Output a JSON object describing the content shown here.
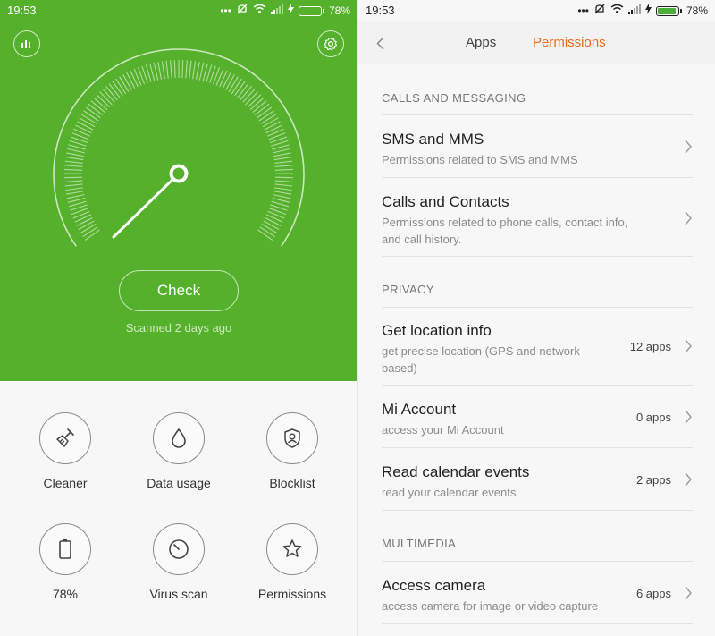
{
  "left": {
    "status": {
      "time": "19:53",
      "battery": "78%"
    },
    "check_label": "Check",
    "scanned_text": "Scanned 2 days ago",
    "tools": [
      {
        "label": "Cleaner",
        "icon": "broom-icon"
      },
      {
        "label": "Data usage",
        "icon": "droplet-icon"
      },
      {
        "label": "Blocklist",
        "icon": "shield-user-icon"
      },
      {
        "label": "78%",
        "icon": "battery-icon"
      },
      {
        "label": "Virus scan",
        "icon": "scan-dial-icon"
      },
      {
        "label": "Permissions",
        "icon": "star-icon"
      }
    ]
  },
  "right": {
    "status": {
      "time": "19:53",
      "battery": "78%"
    },
    "tabs": {
      "apps": "Apps",
      "permissions": "Permissions"
    },
    "sections": {
      "calls": "CALLS AND MESSAGING",
      "privacy": "PRIVACY",
      "multimedia": "MULTIMEDIA"
    },
    "items": {
      "sms": {
        "title": "SMS and MMS",
        "desc": "Permissions related to SMS and MMS"
      },
      "calls": {
        "title": "Calls and Contacts",
        "desc": "Permissions related to phone calls, contact info, and call history."
      },
      "location": {
        "title": "Get location info",
        "desc": "get precise location (GPS and network-based)",
        "count": "12 apps"
      },
      "mi_account": {
        "title": "Mi Account",
        "desc": "access your Mi Account",
        "count": "0 apps"
      },
      "calendar": {
        "title": "Read calendar events",
        "desc": "read your calendar events",
        "count": "2 apps"
      },
      "camera": {
        "title": "Access camera",
        "desc": "access camera for image or video capture",
        "count": "6 apps"
      }
    }
  },
  "colors": {
    "hero_green": "#55b02b",
    "accent_orange": "#ef6a1f",
    "battery_green": "#4caf3a"
  }
}
